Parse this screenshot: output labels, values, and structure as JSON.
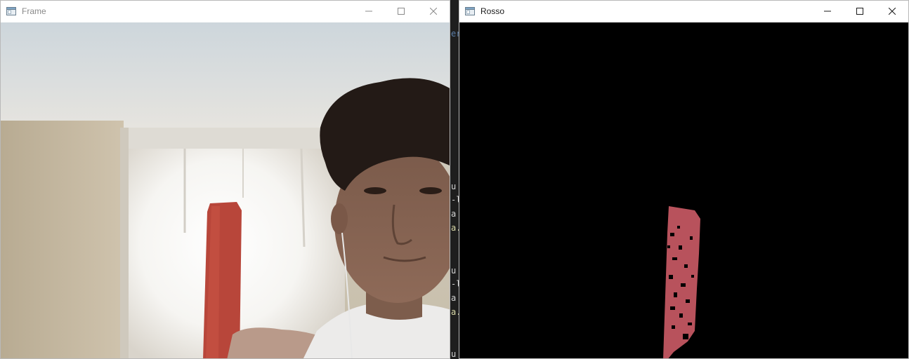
{
  "windows": {
    "frame": {
      "title": "Frame",
      "icon": "opencv-window-icon",
      "controls": [
        "minimize",
        "maximize",
        "close"
      ]
    },
    "rosso": {
      "title": "Rosso",
      "icon": "opencv-window-icon",
      "controls": [
        "minimize",
        "maximize",
        "close"
      ]
    }
  },
  "background_editor": {
    "fragments": [
      "er",
      "u",
      "-l",
      "a",
      "a.",
      "u",
      "-l",
      "a",
      "a.",
      "u"
    ]
  },
  "colors": {
    "titlebar_bg": "#ffffff",
    "editor_bg": "#1e1e1e",
    "mask_bg": "#000000",
    "object_red": "#b8463a",
    "mask_red": "#b8525c"
  }
}
